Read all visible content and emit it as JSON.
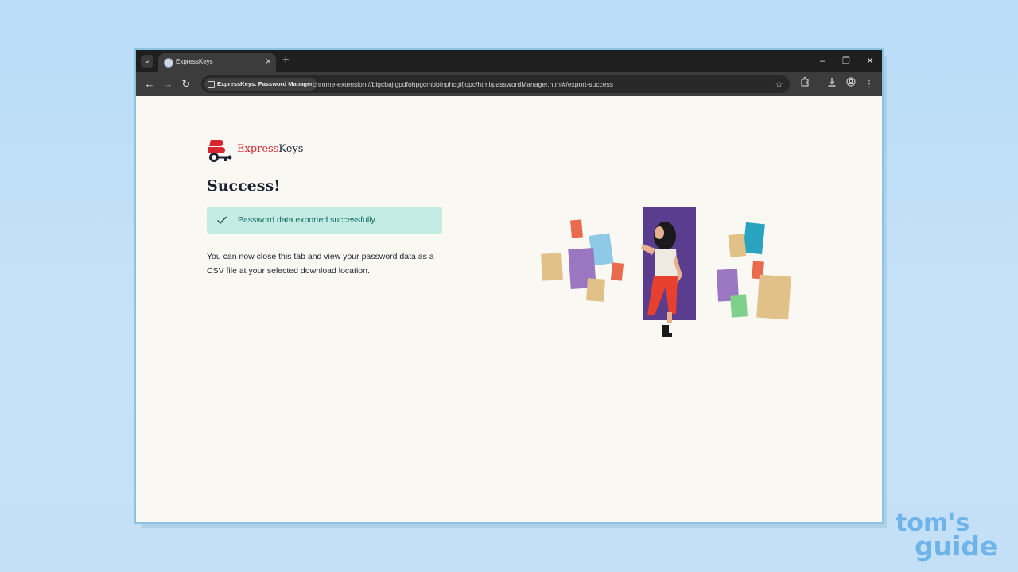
{
  "browser": {
    "tab_title": "ExpressKeys",
    "tab_close": "×",
    "new_tab": "+",
    "site_chip": "ExpressKeys: Password Manager",
    "url": "chrome-extension://blgcbajigpdfohpgcmbbfnphcgifjopc/html/passwordManager.html#/export-success",
    "window_controls": {
      "minimize": "–",
      "restore": "❐",
      "close": "✕"
    }
  },
  "page": {
    "logo_primary": "Express",
    "logo_secondary": "Keys",
    "heading": "Success!",
    "alert_text": "Password data exported successfully.",
    "body": "You can now close this tab and view your password data as a CSV file at your selected download location."
  },
  "colors": {
    "brand_red": "#d7262f",
    "success_bg": "#c5ebe5",
    "success_text": "#0f6b5e",
    "page_bg": "#faf8f3"
  },
  "watermark": {
    "line1": "tom's",
    "line2": "guide"
  }
}
